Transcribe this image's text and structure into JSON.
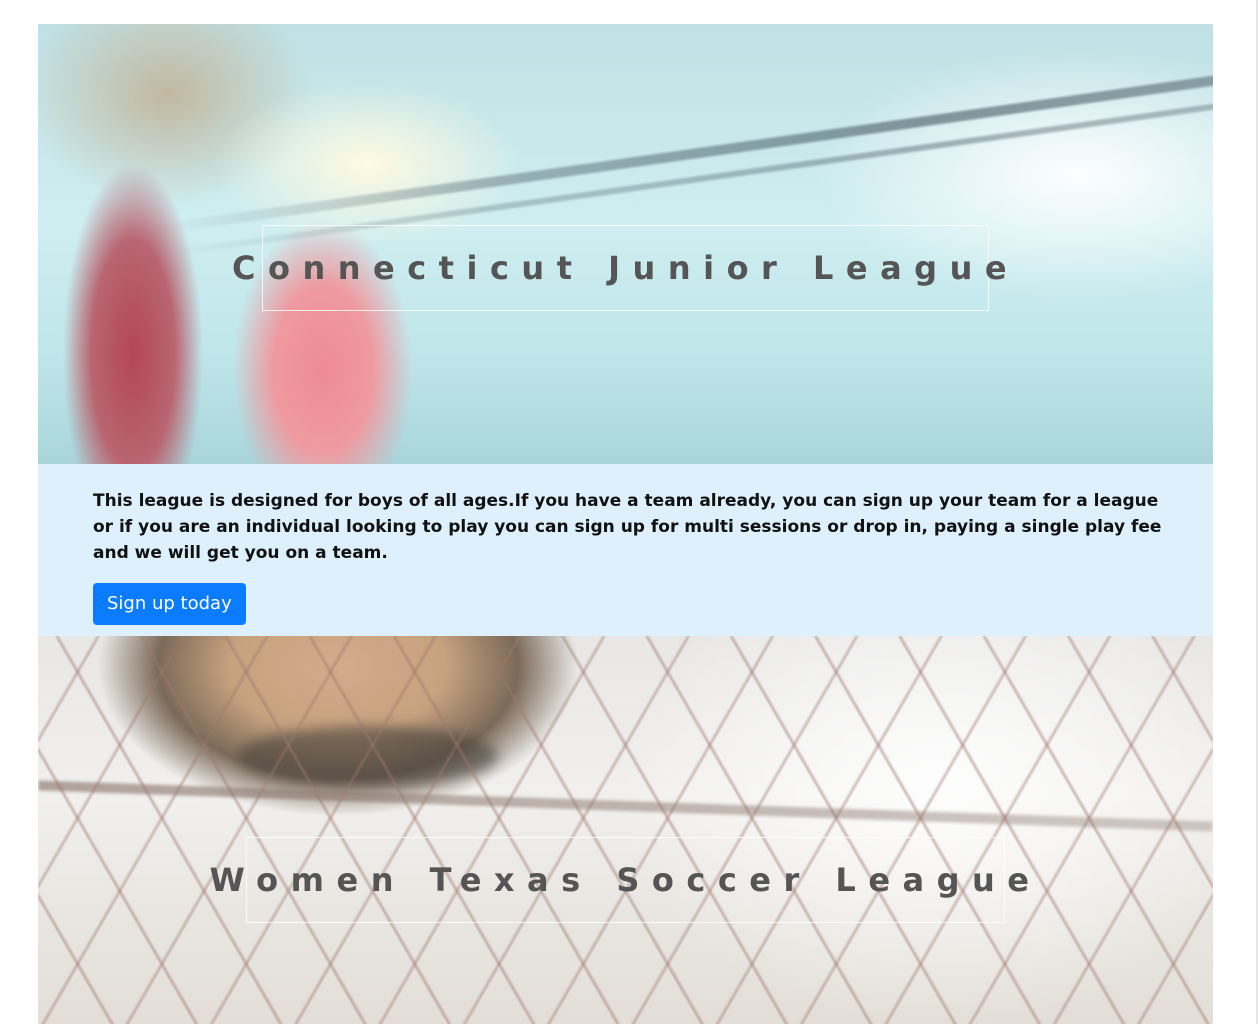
{
  "leagues": [
    {
      "title": "Connecticut Junior League",
      "description": "This league is designed for boys of all ages.If you have a team already, you can sign up your team for a league or if you are an individual looking to play you can sign up for multi sessions or drop in, paying a single play fee and we will get you on a team.",
      "button_label": "Sign up today"
    },
    {
      "title": "Women Texas Soccer League"
    }
  ],
  "colors": {
    "info_background": "#ddf0fc",
    "button": "#0b7bff",
    "title_text": "#555555"
  }
}
